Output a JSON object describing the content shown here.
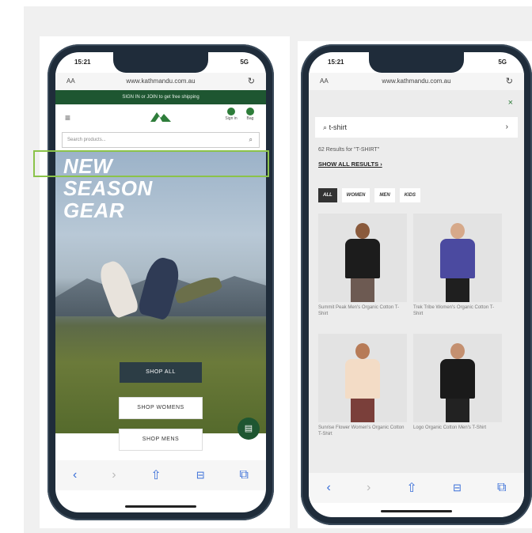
{
  "left_phone": {
    "status": {
      "time": "15:21",
      "signal": "5G"
    },
    "browser": {
      "aa": "AA",
      "url": "www.kathmandu.com.au",
      "reload": "↻"
    },
    "promo": "SIGN IN or JOIN to get free shipping",
    "header": {
      "menu_icon": "≡",
      "sign_in": "Sign in",
      "bag": "Bag"
    },
    "search": {
      "placeholder": "Search products...",
      "icon": "⌕"
    },
    "hero": {
      "line1": "NEW",
      "line2": "SEASON",
      "line3": "GEAR"
    },
    "buttons": {
      "shop_all": "SHOP ALL",
      "shop_womens": "SHOP WOMENS",
      "shop_mens": "SHOP MENS"
    },
    "chat_icon": "▤",
    "toolbar": {
      "back": "‹",
      "forward": "›",
      "share": "⇧",
      "bookmarks": "📖",
      "tabs": "⧉"
    }
  },
  "right_phone": {
    "status": {
      "time": "15:21",
      "signal": "5G"
    },
    "browser": {
      "aa": "AA",
      "url": "www.kathmandu.com.au",
      "reload": "↻"
    },
    "close": "×",
    "search": {
      "value": "t-shirt",
      "chevron": "›",
      "icon": "⌕"
    },
    "results_text": "62 Results for \"T-SHIRT\"",
    "show_all": "SHOW ALL RESULTS ›",
    "filters": [
      "ALL",
      "WOMEN",
      "MEN",
      "KIDS"
    ],
    "products": [
      {
        "caption": "Summit Peak Men's Organic Cotton T-Shirt",
        "shirt": "#1c1c1c",
        "skin": "#8a5a3c",
        "legs": "#6d5a52"
      },
      {
        "caption": "Trek Tribe Women's Organic Cotton T-Shirt",
        "shirt": "#4b4aa0",
        "skin": "#d6a98a",
        "legs": "#1f1f1f"
      },
      {
        "caption": "Sunrise Flower Women's Organic Cotton T-Shirt",
        "shirt": "#f3dcc6",
        "skin": "#b77b57",
        "legs": "#7a3f3a"
      },
      {
        "caption": "Logo Organic Cotton Men's T-Shirt",
        "shirt": "#1a1a1a",
        "skin": "#c49070",
        "legs": "#222222"
      }
    ],
    "toolbar": {
      "back": "‹",
      "forward": "›",
      "share": "⇧",
      "bookmarks": "📖",
      "tabs": "⧉"
    }
  },
  "colors": {
    "brand_green": "#1e5631",
    "highlight": "#8bc34a",
    "ios_blue": "#3a6fd8"
  }
}
